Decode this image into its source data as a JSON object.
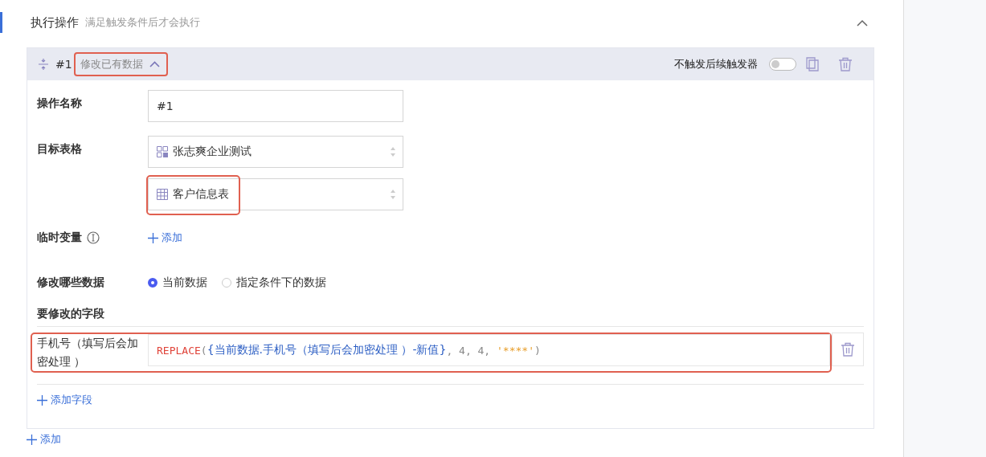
{
  "section": {
    "title": "执行操作",
    "subtitle": "满足触发条件后才会执行",
    "expanded": true
  },
  "action": {
    "number": "#1",
    "type": "修改已有数据",
    "expanded": true,
    "highlighted": true,
    "no_trigger_label": "不触发后续触发器",
    "no_trigger_on": false
  },
  "name_field": {
    "label": "操作名称",
    "value": "#1"
  },
  "target": {
    "label": "目标表格",
    "selects": [
      {
        "kind": "app",
        "value": "张志爽企业测试",
        "highlighted": false
      },
      {
        "kind": "table",
        "value": "客户信息表",
        "highlighted": true
      }
    ]
  },
  "variables": {
    "label": "临时变量",
    "add": "添加"
  },
  "scope": {
    "label": "修改哪些数据",
    "options": [
      {
        "label": "当前数据",
        "selected": true
      },
      {
        "label": "指定条件下的数据",
        "selected": false
      }
    ]
  },
  "fields": {
    "label": "要修改的字段",
    "rows": [
      {
        "name": "手机号（填写后会加密处理 ）",
        "highlighted": true,
        "formula": [
          {
            "kind": "func",
            "text": "REPLACE"
          },
          {
            "kind": "punct",
            "text": "("
          },
          {
            "kind": "ref",
            "text": "{当前数据.手机号（填写后会加密处理 ）-新值}"
          },
          {
            "kind": "punct",
            "text": ", 4, 4, "
          },
          {
            "kind": "string",
            "text": "'****'"
          },
          {
            "kind": "punct",
            "text": ")"
          }
        ]
      }
    ],
    "add": "添加字段"
  },
  "add_action": "添加"
}
